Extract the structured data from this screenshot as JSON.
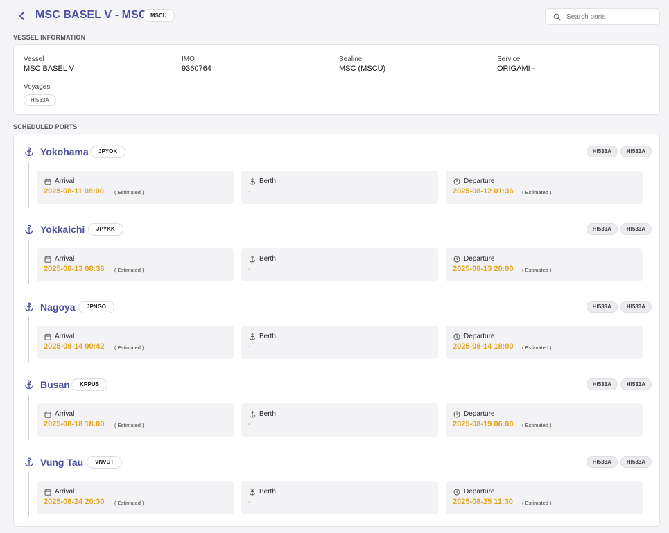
{
  "header": {
    "title": "MSC BASEL V - MSC",
    "badge": "MSCU",
    "search_placeholder": "Search ports"
  },
  "vessel_info": {
    "section_label": "VESSEL INFORMATION",
    "vessel_label": "Vessel",
    "vessel_value": "MSC BASEL V",
    "imo_label": "IMO",
    "imo_value": "9360764",
    "sealine_label": "Sealine",
    "sealine_value": "MSC (MSCU)",
    "service_label": "Service",
    "service_value": "ORIGAMI -",
    "voyages_label": "Voyages",
    "voyages": [
      "HI533A"
    ]
  },
  "scheduled_ports": {
    "section_label": "SCHEDULED PORTS",
    "arrival_label": "Arrival",
    "berth_label": "Berth",
    "departure_label": "Departure",
    "estimated_note": "( Estimated )",
    "berth_empty": "-",
    "ports": [
      {
        "name": "Yokohama",
        "code": "JPYOK",
        "voyages": [
          "HI533A",
          "HI533A"
        ],
        "arrival": "2025-08-11 08:00",
        "departure": "2025-08-12 01:36"
      },
      {
        "name": "Yokkaichi",
        "code": "JPYKK",
        "voyages": [
          "HI533A",
          "HI533A"
        ],
        "arrival": "2025-08-13 08:36",
        "departure": "2025-08-13 20:00"
      },
      {
        "name": "Nagoya",
        "code": "JPNGO",
        "voyages": [
          "HI533A",
          "HI533A"
        ],
        "arrival": "2025-08-14 00:42",
        "departure": "2025-08-14 18:00"
      },
      {
        "name": "Busan",
        "code": "KRPUS",
        "voyages": [
          "HI533A",
          "HI533A"
        ],
        "arrival": "2025-08-18 18:00",
        "departure": "2025-08-19 06:00"
      },
      {
        "name": "Vung Tau",
        "code": "VNVUT",
        "voyages": [
          "HI533A",
          "HI533A"
        ],
        "arrival": "2025-08-24 20:30",
        "departure": "2025-08-25 11:30"
      }
    ]
  },
  "colors": {
    "accent": "#4b4f9e",
    "time_value": "#e6a21b"
  },
  "icons": {
    "back": "chevron-left-icon",
    "search": "search-icon",
    "port": "anchor-icon",
    "arrival": "calendar-icon",
    "berth": "anchor-icon",
    "departure": "clock-icon"
  }
}
